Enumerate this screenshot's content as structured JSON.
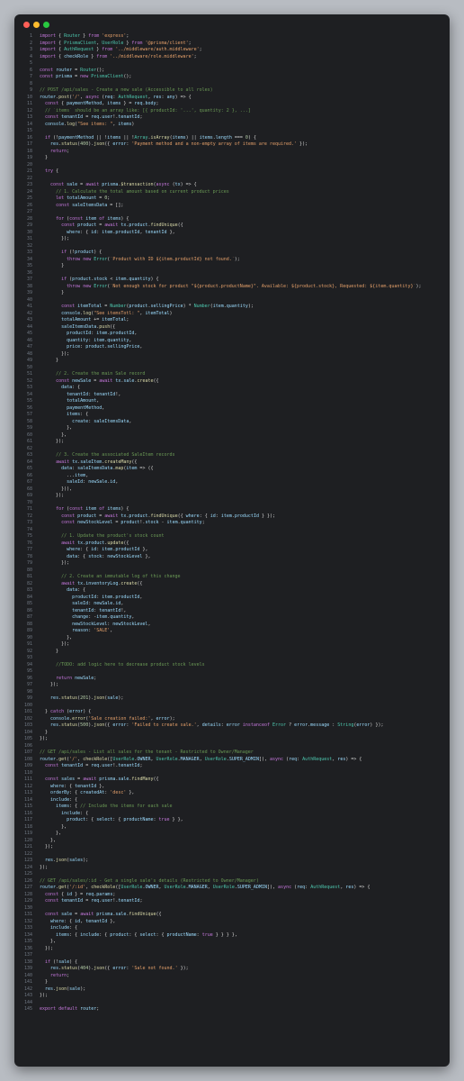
{
  "window": {
    "buttons": [
      "close",
      "minimize",
      "maximize"
    ]
  },
  "colors": {
    "background": "#1e1f22",
    "keyword": "#c678dd",
    "string": "#e5a06a",
    "comment": "#6a9955",
    "function": "#dcdcaa",
    "type": "#4ec9b0",
    "variable": "#9cdcfe",
    "line_number": "#6e7681"
  },
  "editor": {
    "lines": [
      "import { Router } from 'express';",
      "import { PrismaClient, UserRole } from '@prisma/client';",
      "import { AuthRequest } from '../middleware/auth.middleware';",
      "import { checkRole } from '../middleware/role.middleware';",
      "",
      "const router = Router();",
      "const prisma = new PrismaClient();",
      "",
      "// POST /api/sales - Create a new sale (Accessible to all roles)",
      "router.post('/', async (req: AuthRequest, res: any) => {",
      "  const { paymentMethod, items } = req.body;",
      "  // `items` should be an array like: [{ productId: '...', quantity: 2 }, ...]",
      "  const tenantId = req.user!.tenantId;",
      "  console.log(\"See items: \", items)",
      "",
      "  if (!paymentMethod || !items || !Array.isArray(items) || items.length === 0) {",
      "    res.status(400).json({ error: 'Payment method and a non-empty array of items are required.' });",
      "    return;",
      "  }",
      "",
      "  try {",
      "",
      "    const sale = await prisma.$transaction(async (tx) => {",
      "      // 1. Calculate the total amount based on current product prices",
      "      let totalAmount = 0;",
      "      const saleItemsData = [];",
      "",
      "      for (const item of items) {",
      "        const product = await tx.product.findUnique({",
      "          where: { id: item.productId, tenantId },",
      "        });",
      "",
      "        if (!product) {",
      "          throw new Error(`Product with ID ${item.productId} not found.`);",
      "        }",
      "",
      "        if (product.stock < item.quantity) {",
      "          throw new Error(`Not enough stock for product \"${product.productName}\". Available: ${product.stock}, Requested: ${item.quantity}`);",
      "        }",
      "",
      "        const itemTotal = Number(product.sellingPrice) * Number(item.quantity);",
      "        console.log(\"See itemsTotl: \", itemTotal)",
      "        totalAmount += itemTotal;",
      "        saleItemsData.push({",
      "          productId: item.productId,",
      "          quantity: item.quantity,",
      "          price: product.sellingPrice,",
      "        });",
      "      }",
      "",
      "      // 2. Create the main Sale record",
      "      const newSale = await tx.sale.create({",
      "        data: {",
      "          tenantId: tenantId!,",
      "          totalAmount,",
      "          paymentMethod,",
      "          items: {",
      "            create: saleItemsData,",
      "          },",
      "        },",
      "      });",
      "",
      "      // 3. Create the associated SaleItem records",
      "      await tx.saleItem.createMany({",
      "        data: saleItemsData.map(item => ({",
      "          ...item,",
      "          saleId: newSale.id,",
      "        })),",
      "      });",
      "",
      "      for (const item of items) {",
      "        const product = await tx.product.findUnique({ where: { id: item.productId } });",
      "        const newStockLevel = product!.stock - item.quantity;",
      "",
      "        // 1. Update the product's stock count",
      "        await tx.product.update({",
      "          where: { id: item.productId },",
      "          data: { stock: newStockLevel },",
      "        });",
      "",
      "        // 2. Create an immutable log of this change",
      "        await tx.inventoryLog.create({",
      "          data: {",
      "            productId: item.productId,",
      "            saleId: newSale.id,",
      "            tenantId: tenantId!,",
      "            change: -item.quantity,",
      "            newStockLevel: newStockLevel,",
      "            reason: 'SALE',",
      "          },",
      "        });",
      "      }",
      "",
      "      //TODO: add logic here to decrease product stock levels",
      "",
      "      return newSale;",
      "    });",
      "",
      "    res.status(201).json(sale);",
      "",
      "  } catch (error) {",
      "    console.error('Sale creation failed:', error);",
      "    res.status(500).json({ error: 'Failed to create sale.', details: error instanceof Error ? error.message : String(error) });",
      "  }",
      "});",
      "",
      "// GET /api/sales - List all sales for the tenant - Restricted to Owner/Manager",
      "router.get('/', checkRole([UserRole.OWNER, UserRole.MANAGER, UserRole.SUPER_ADMIN]), async (req: AuthRequest, res) => {",
      "  const tenantId = req.user!.tenantId;",
      "",
      "  const sales = await prisma.sale.findMany({",
      "    where: { tenantId },",
      "    orderBy: { createdAt: 'desc' },",
      "    include: {",
      "      items: { // Include the items for each sale",
      "        include: {",
      "          product: { select: { productName: true } },",
      "        },",
      "      },",
      "    },",
      "  });",
      "",
      "  res.json(sales);",
      "});",
      "",
      "// GET /api/sales/:id - Get a single sale's details (Restricted to Owner/Manager)",
      "router.get('/:id', checkRole([UserRole.OWNER, UserRole.MANAGER, UserRole.SUPER_ADMIN]), async (req: AuthRequest, res) => {",
      "  const { id } = req.params;",
      "  const tenantId = req.user!.tenantId;",
      "",
      "  const sale = await prisma.sale.findUnique({",
      "    where: { id, tenantId },",
      "    include: {",
      "      items: { include: { product: { select: { productName: true } } } },",
      "    },",
      "  });",
      "",
      "  if (!sale) {",
      "    res.status(404).json({ error: 'Sale not found.' });",
      "    return;",
      "  }",
      "  res.json(sale);",
      "});",
      "",
      "export default router;"
    ]
  }
}
